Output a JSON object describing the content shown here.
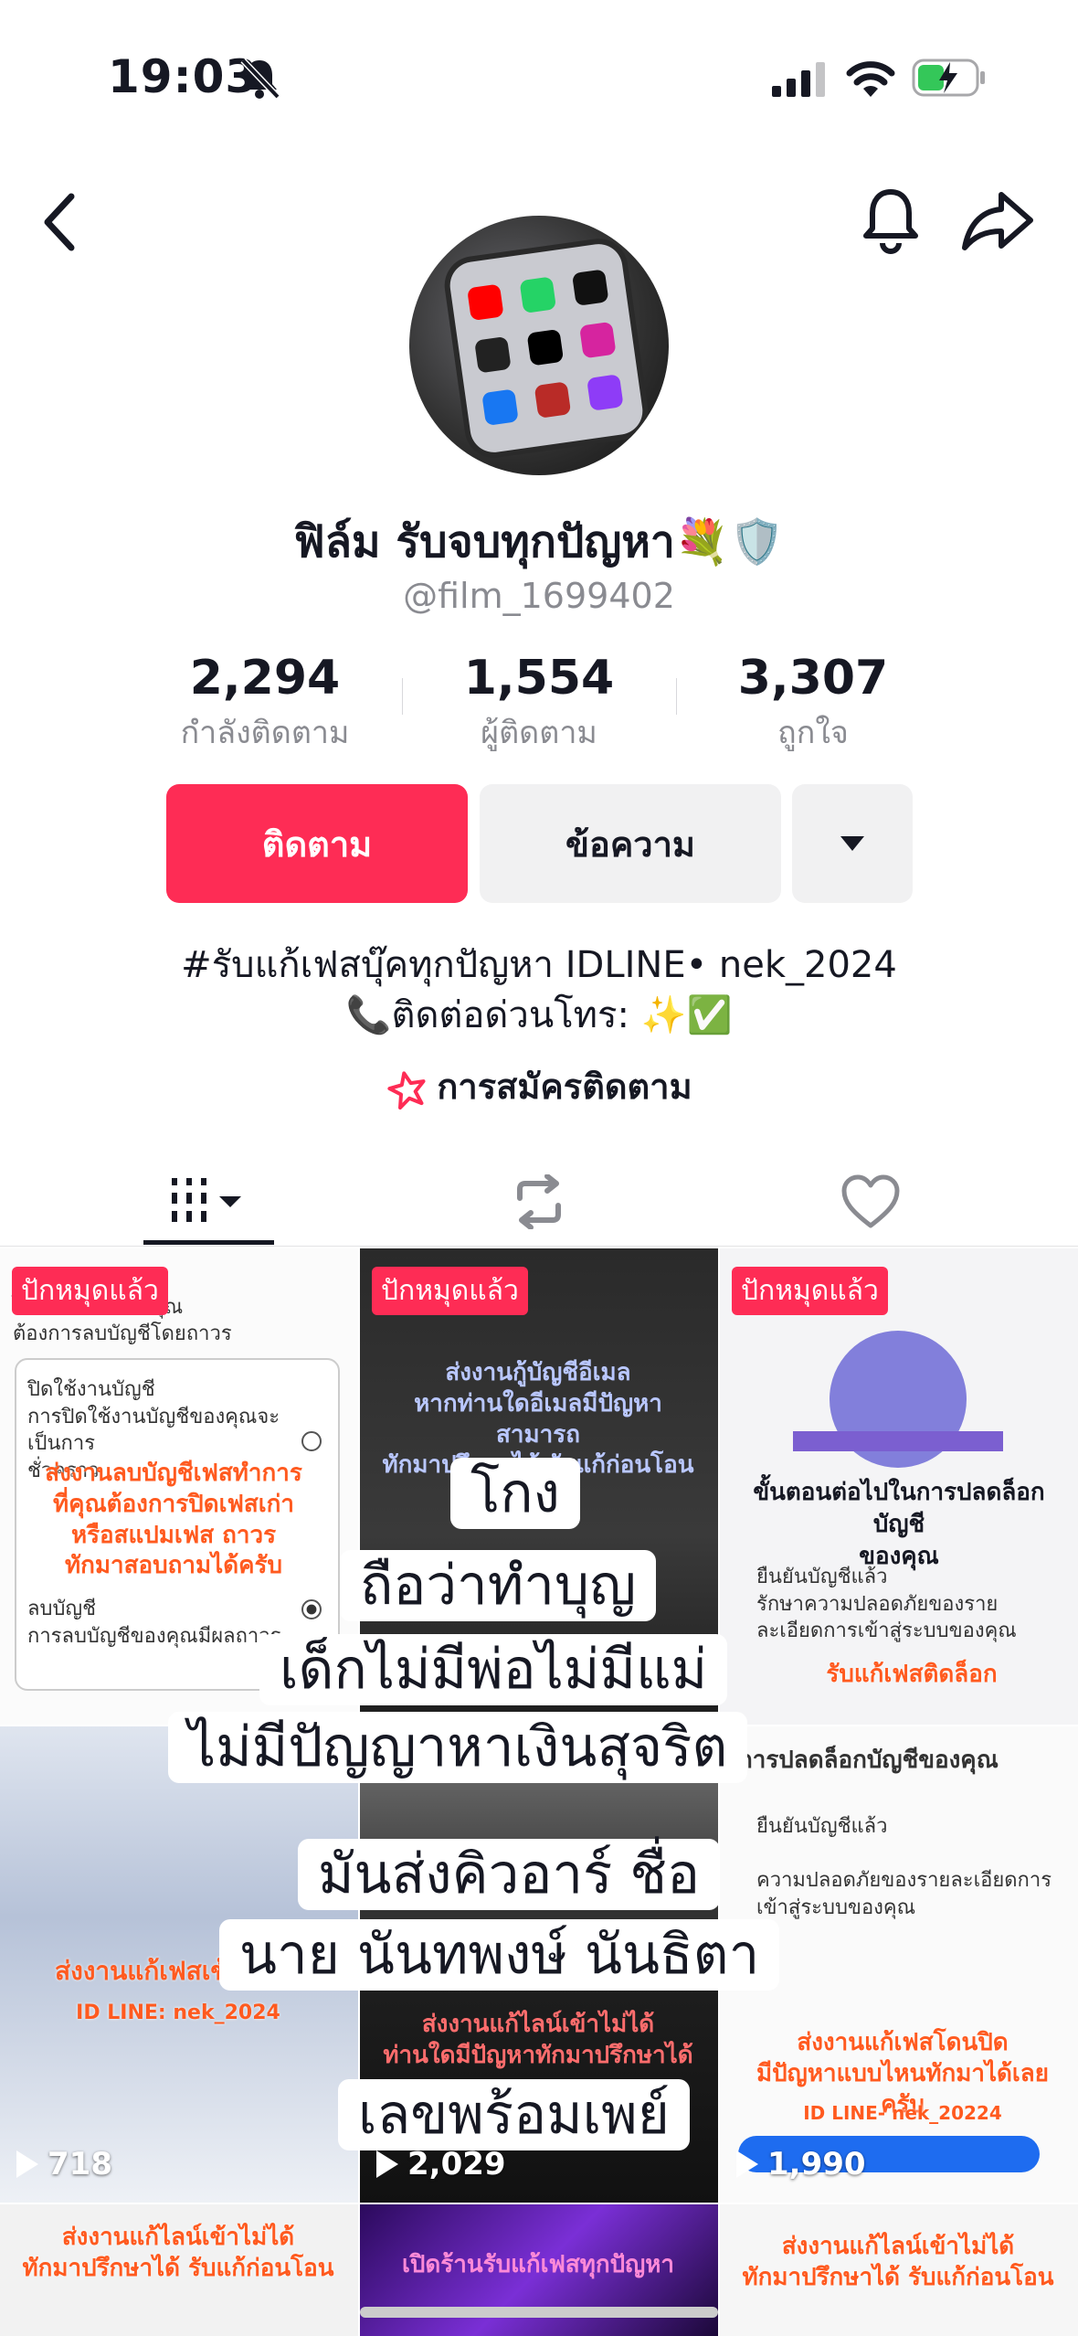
{
  "status_bar": {
    "time": "19:03"
  },
  "profile": {
    "display_name": "ฟิล์ม รับจบทุกปัญหา💐🛡️",
    "username": "@film_1699402",
    "stats": [
      {
        "value": "2,294",
        "label": "กำลังติดตาม"
      },
      {
        "value": "1,554",
        "label": "ผู้ติดตาม"
      },
      {
        "value": "3,307",
        "label": "ถูกใจ"
      }
    ],
    "follow_label": "ติดตาม",
    "message_label": "ข้อความ",
    "bio_line1": "#รับแก้เฟสบุ๊คทุกปัญหา IDLINE• nek_2024",
    "bio_line2": "📞ติดต่อด่วนโทร:   ✨✅",
    "subscribe_label": "การสมัครติดตาม"
  },
  "grid": {
    "pinned_label": "ปักหมุดแล้ว",
    "views": [
      "718",
      "2,029",
      "1,990"
    ]
  },
  "overlay_caption": [
    "โกง",
    "ถือว่าทำบุญ",
    "เด็กไม่มีพ่อไม่มีแม่",
    "ไม่มีปัญญาหาเงินสุจริต",
    "มันส่งคิวอาร์ ชื่อ",
    "นาย นันทพงษ์ นันธิตา",
    "เลขพร้อมเพย์"
  ],
  "colors": {
    "accent": "#fe2c55",
    "text": "#161823",
    "secondary": "#8a8b91"
  }
}
